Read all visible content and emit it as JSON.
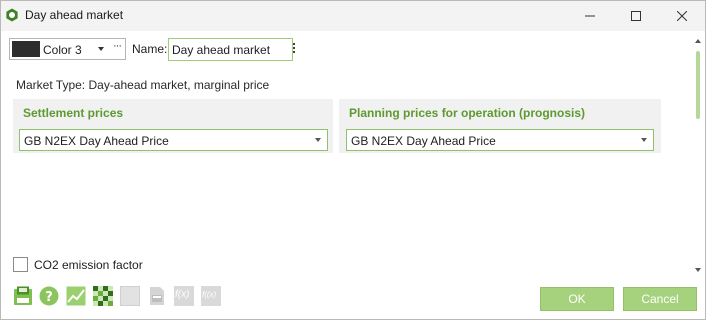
{
  "window": {
    "title": "Day ahead market",
    "controls": [
      "minimize-icon",
      "maximize-icon",
      "close-icon"
    ]
  },
  "header": {
    "color_label": "Color 3",
    "color_swatch": "#2d2d2d",
    "color_more": "···",
    "name_label": "Name:",
    "name_value": "Day ahead market"
  },
  "market_type": "Market Type: Day-ahead market, marginal price",
  "settlement": {
    "title": "Settlement prices",
    "selected": "GB N2EX Day Ahead Price"
  },
  "planning": {
    "title": "Planning prices for operation (prognosis)",
    "selected": "GB N2EX Day Ahead Price"
  },
  "co2": {
    "label": "CO2 emission factor",
    "checked": false
  },
  "toolbar": {
    "icons": [
      "save-icon",
      "help-icon",
      "chart-icon",
      "grid-icon",
      "blank-icon",
      "document-icon",
      "fx-icon",
      "fx-paren-icon"
    ],
    "fx_label": "f(x)",
    "fx_paren_label": "f((x)"
  },
  "buttons": {
    "ok": "OK",
    "cancel": "Cancel"
  },
  "colors": {
    "accent": "#5d9a2f",
    "button": "#a6d27e",
    "border_green": "#8fc26a",
    "panel_bg": "#f1f1f1",
    "titlebar_bg": "#f3f3f3"
  }
}
